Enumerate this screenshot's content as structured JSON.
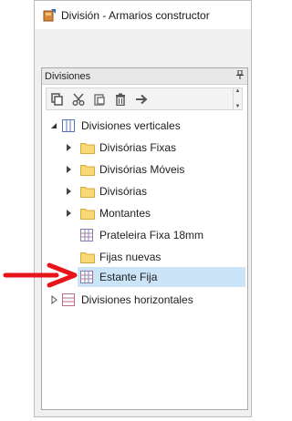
{
  "window": {
    "title": "División - Armarios constructor"
  },
  "panel": {
    "title": "Divisiones",
    "pin": "ᛖ"
  },
  "toolbar": {
    "buttons": [
      "copy-icon",
      "cut-icon",
      "paste-icon",
      "delete-icon",
      "move-right-icon"
    ]
  },
  "tree": {
    "root_vertical": "Divisiones verticales",
    "children": [
      {
        "label": "Divisórias Fixas",
        "type": "folder",
        "expandable": true
      },
      {
        "label": "Divisórias Móveis",
        "type": "folder",
        "expandable": true
      },
      {
        "label": "Divisórias",
        "type": "folder",
        "expandable": true
      },
      {
        "label": "Montantes",
        "type": "folder",
        "expandable": true
      },
      {
        "label": "Prateleira Fixa 18mm",
        "type": "grid",
        "expandable": false
      },
      {
        "label": "Fijas nuevas",
        "type": "folder",
        "expandable": false
      },
      {
        "label": "Estante Fija",
        "type": "grid",
        "expandable": false,
        "selected": true
      }
    ],
    "root_horizontal": "Divisiones horizontales"
  },
  "colors": {
    "selection": "#cce4f7",
    "folder": "#f8d775",
    "arrow": "#e8141b"
  }
}
